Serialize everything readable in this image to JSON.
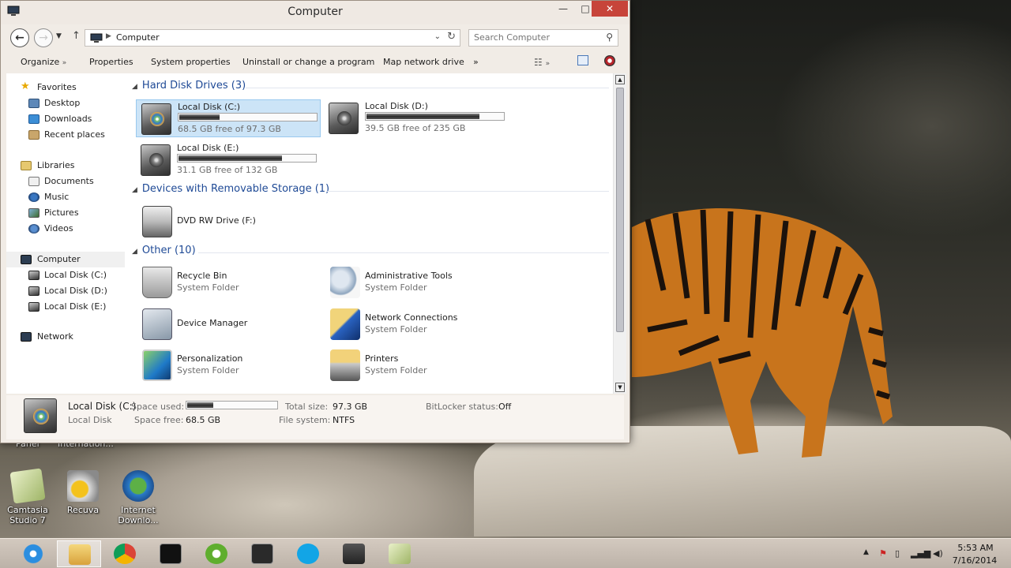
{
  "window": {
    "title": "Computer",
    "controls": {
      "minimize": "—",
      "maximize": "□",
      "close": "✕"
    }
  },
  "address": {
    "back": "←",
    "forward": "→",
    "path": "Computer",
    "search_placeholder": "Search Computer"
  },
  "toolbar": {
    "organize": "Organize",
    "properties": "Properties",
    "system_properties": "System properties",
    "uninstall": "Uninstall or change a program",
    "map_drive": "Map network drive",
    "more": "»"
  },
  "nav": {
    "favorites": "Favorites",
    "desktop": "Desktop",
    "downloads": "Downloads",
    "recent": "Recent places",
    "libraries": "Libraries",
    "documents": "Documents",
    "music": "Music",
    "pictures": "Pictures",
    "videos": "Videos",
    "computer": "Computer",
    "disk_c": "Local Disk (C:)",
    "disk_d": "Local Disk (D:)",
    "disk_e": "Local Disk (E:)",
    "network": "Network"
  },
  "groups": {
    "hard_disks": "Hard Disk Drives (3)",
    "removable": "Devices with Removable Storage (1)",
    "other": "Other (10)"
  },
  "drives": [
    {
      "name": "Local Disk (C:)",
      "free": "68.5 GB free of 97.3 GB",
      "used_fraction": 0.3
    },
    {
      "name": "Local Disk (D:)",
      "free": "39.5 GB free of 235 GB",
      "used_fraction": 0.83
    },
    {
      "name": "Local Disk (E:)",
      "free": "31.1 GB free of 132 GB",
      "used_fraction": 0.76
    }
  ],
  "removable": {
    "name": "DVD RW Drive (F:)"
  },
  "other_items": [
    {
      "name": "Recycle Bin",
      "sub": "System Folder"
    },
    {
      "name": "Administrative Tools",
      "sub": "System Folder"
    },
    {
      "name": "Device Manager",
      "sub": ""
    },
    {
      "name": "Network Connections",
      "sub": "System Folder"
    },
    {
      "name": "Personalization",
      "sub": "System Folder"
    },
    {
      "name": "Printers",
      "sub": "System Folder"
    }
  ],
  "details": {
    "name": "Local Disk (C:)",
    "type": "Local Disk",
    "space_used_label": "Space used:",
    "used_fraction": 0.3,
    "space_free_label": "Space free:",
    "space_free": "68.5 GB",
    "total_size_label": "Total size:",
    "total_size": "97.3 GB",
    "file_system_label": "File system:",
    "file_system": "NTFS",
    "bitlocker_label": "BitLocker status:",
    "bitlocker": "Off"
  },
  "desktop_icons": [
    {
      "label1": "Camtasia",
      "label2": "Studio 7"
    },
    {
      "label1": "Recuva",
      "label2": ""
    },
    {
      "label1": "Internet",
      "label2": "Downlo..."
    }
  ],
  "desktop_partial": {
    "left": "Panel",
    "right": "Internation..."
  },
  "clock": {
    "time": "5:53 AM",
    "date": "7/16/2014"
  },
  "colors": {
    "accent_blue": "#1f4a96",
    "close_red": "#c7443a",
    "selection": "#cce4f7"
  }
}
